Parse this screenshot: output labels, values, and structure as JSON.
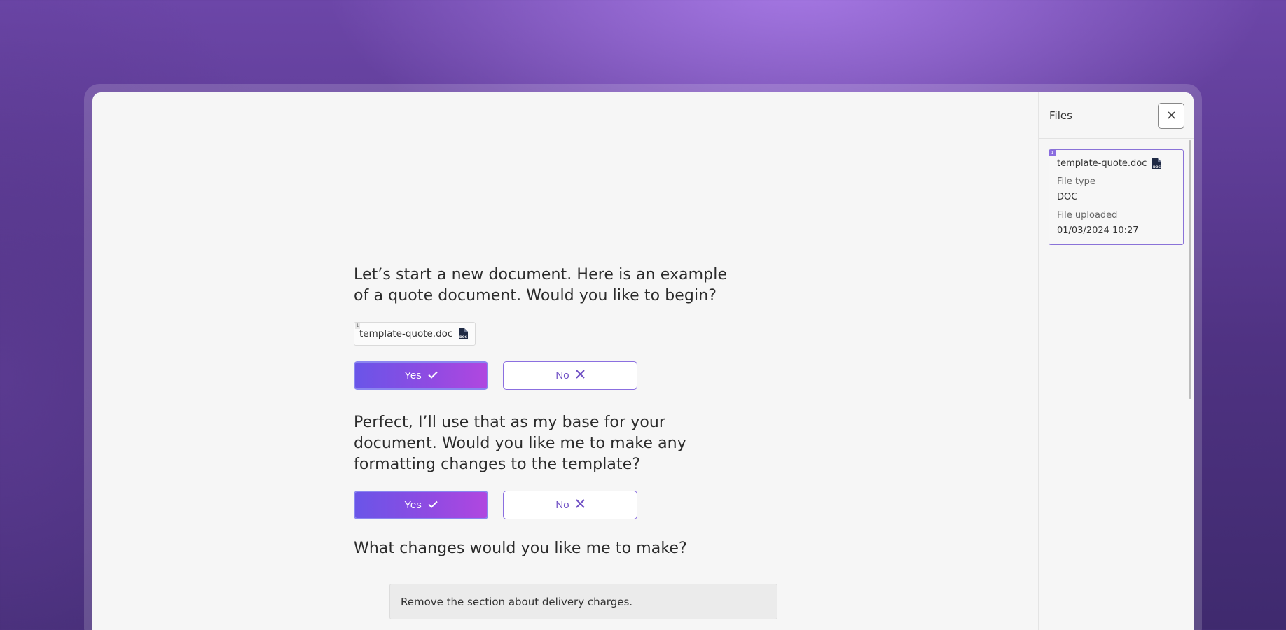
{
  "chat": {
    "messages": [
      {
        "text": "Let’s start a new document. Here is an example of a quote document. Would you like to begin?"
      },
      {
        "text": "Perfect, I’ll use that as my base for your document. Would you like me to make any formatting changes to the template?"
      },
      {
        "text": "What changes would you like me to make?"
      }
    ],
    "attachment": {
      "index": "1",
      "name": "template-quote.doc",
      "icon": "doc-file-icon"
    },
    "choices": [
      {
        "yes_label": "Yes",
        "no_label": "No"
      },
      {
        "yes_label": "Yes",
        "no_label": "No"
      }
    ],
    "user_reply": "Remove the section about delivery charges."
  },
  "files_panel": {
    "title": "Files",
    "close_icon": "close-icon",
    "file": {
      "index": "1",
      "name": "template-quote.doc",
      "type_label": "File type",
      "type_value": "DOC",
      "uploaded_label": "File uploaded",
      "uploaded_value": "01/03/2024 10:27"
    }
  },
  "colors": {
    "accent_start": "#6a55e8",
    "accent_end": "#b047e0",
    "outline": "#8b6fe0"
  }
}
